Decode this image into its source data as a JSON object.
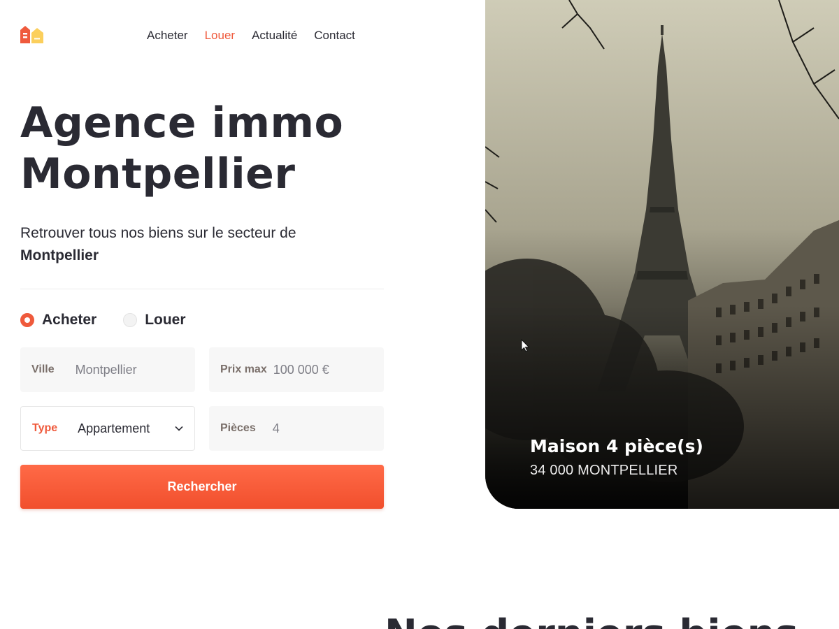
{
  "nav": {
    "items": [
      {
        "label": "Acheter",
        "active": false
      },
      {
        "label": "Louer",
        "active": true
      },
      {
        "label": "Actualité",
        "active": false
      },
      {
        "label": "Contact",
        "active": false
      }
    ]
  },
  "hero": {
    "title_line1": "Agence immo",
    "title_line2": "Montpellier",
    "subtitle": "Retrouver tous nos biens sur le secteur de",
    "subtitle_city": "Montpellier"
  },
  "search": {
    "mode_buy": "Acheter",
    "mode_rent": "Louer",
    "selected_mode": "Acheter",
    "city_label": "Ville",
    "city_value": "Montpellier",
    "price_label": "Prix max",
    "price_value": "100 000 €",
    "type_label": "Type",
    "type_value": "Appartement",
    "rooms_label": "Pièces",
    "rooms_value": "4",
    "submit_label": "Rechercher"
  },
  "featured": {
    "title": "Maison 4 pièce(s)",
    "address": "34 000 MONTPELLIER"
  },
  "section": {
    "heading": "Nos derniers biens"
  },
  "colors": {
    "accent": "#ef5a3c",
    "text": "#2a2a33",
    "field_bg": "#f7f7f7",
    "logo_secondary": "#fbcf5c"
  },
  "icons": {
    "logo": "houses-logo-icon",
    "type_dropdown": "chevron-down-icon",
    "pointer": "mouse-cursor-icon"
  }
}
